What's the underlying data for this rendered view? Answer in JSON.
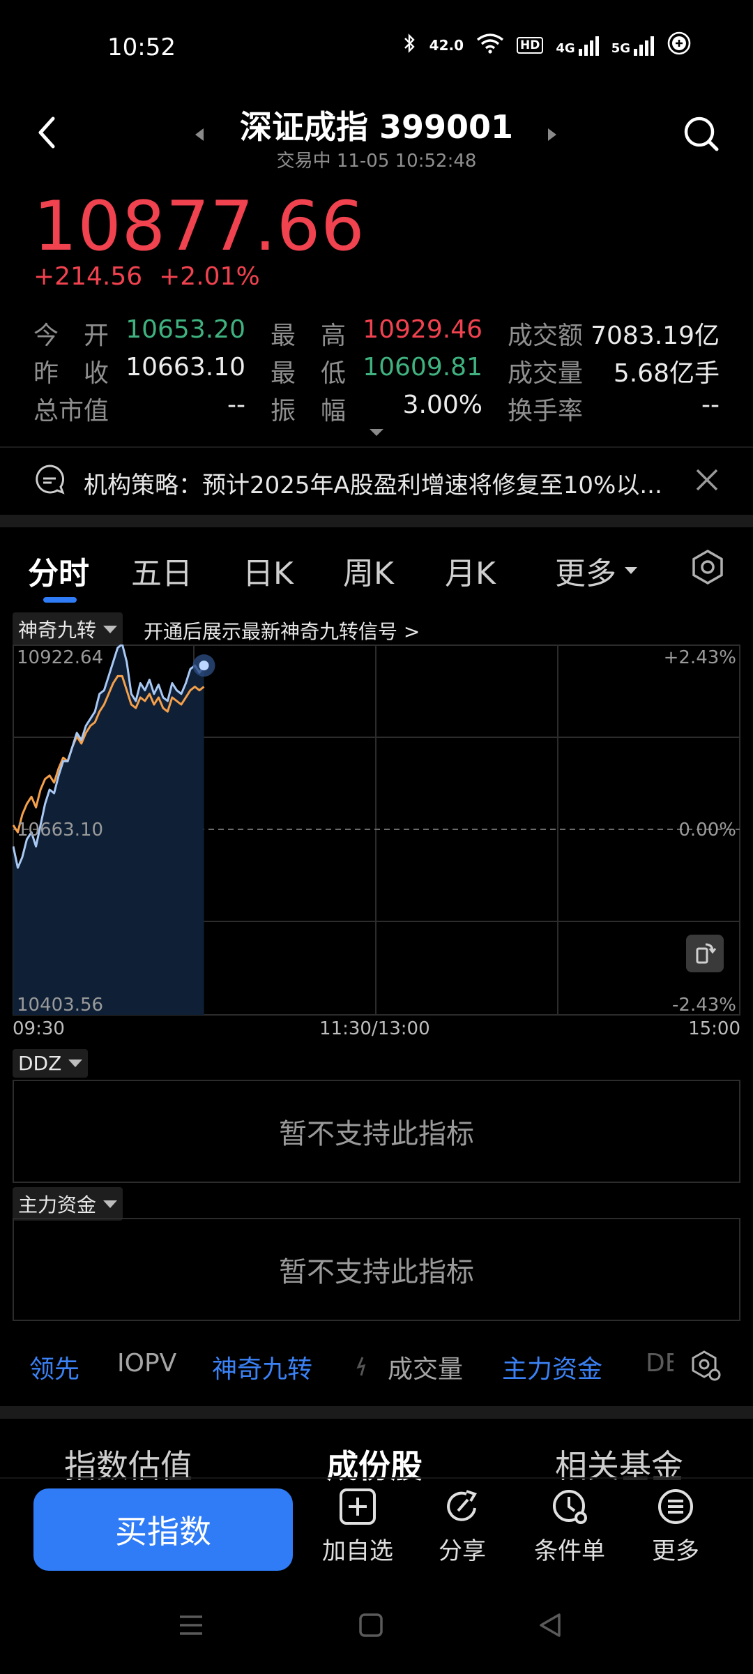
{
  "status_bar": {
    "time": "10:52",
    "speed": "42.0",
    "hd_label": "HD",
    "net1": "4G",
    "net2": "5G"
  },
  "header": {
    "title": "深证成指 399001",
    "subtitle": "交易中 11-05 10:52:48"
  },
  "quote": {
    "price": "10877.66",
    "change": "+214.56",
    "change_pct": "+2.01%",
    "stats": [
      {
        "label": "今　开",
        "value": "10653.20",
        "color": "green"
      },
      {
        "label": "最　高",
        "value": "10929.46",
        "color": "red"
      },
      {
        "label": "成交额",
        "value": "7083.19亿",
        "color": "white"
      },
      {
        "label": "昨　收",
        "value": "10663.10",
        "color": "white"
      },
      {
        "label": "最　低",
        "value": "10609.81",
        "color": "green"
      },
      {
        "label": "成交量",
        "value": "5.68亿手",
        "color": "white"
      },
      {
        "label": "总市值",
        "value": "--",
        "color": "white"
      },
      {
        "label": "振　幅",
        "value": "3.00%",
        "color": "white"
      },
      {
        "label": "换手率",
        "value": "--",
        "color": "white"
      }
    ]
  },
  "news": {
    "text": "机构策略：预计2025年A股盈利增速将修复至10%以..."
  },
  "chart_tabs": [
    "分时",
    "五日",
    "日K",
    "周K",
    "月K",
    "更多"
  ],
  "chart_header": {
    "indicator": "神奇九转",
    "promo": "开通后展示最新神奇九转信号 >"
  },
  "chart_data": {
    "type": "line",
    "y_labels": {
      "top": "10922.64",
      "mid": "10663.10",
      "bottom": "10403.56"
    },
    "pct_labels": {
      "top": "+2.43%",
      "mid": "0.00%",
      "bottom": "-2.43%"
    },
    "x_labels": [
      "09:30",
      "11:30/13:00",
      "15:00"
    ],
    "ylim": [
      10403.56,
      10922.64
    ],
    "x_minutes_total": 240,
    "series": [
      {
        "color": "#a9c9f5",
        "values": [
          10640,
          10610,
          10625,
          10650,
          10660,
          10640,
          10670,
          10700,
          10720,
          10715,
          10740,
          10760,
          10760,
          10780,
          10800,
          10790,
          10810,
          10820,
          10830,
          10855,
          10860,
          10880,
          10900,
          10920,
          10925,
          10900,
          10855,
          10845,
          10870,
          10860,
          10875,
          10855,
          10868,
          10850,
          10845,
          10870,
          10860,
          10855,
          10870,
          10890,
          10895,
          10885,
          10895
        ],
        "minutes_step": 1.5
      },
      {
        "color": "#f5a04a",
        "values": [
          10670,
          10660,
          10685,
          10700,
          10710,
          10695,
          10720,
          10735,
          10740,
          10730,
          10750,
          10765,
          10760,
          10780,
          10795,
          10785,
          10800,
          10810,
          10815,
          10830,
          10840,
          10855,
          10870,
          10880,
          10880,
          10860,
          10840,
          10835,
          10850,
          10845,
          10855,
          10840,
          10850,
          10835,
          10830,
          10850,
          10845,
          10840,
          10850,
          10860,
          10865,
          10860,
          10865
        ],
        "minutes_step": 1.5
      }
    ]
  },
  "indicator_panels": [
    {
      "name": "DDZ",
      "message": "暂不支持此指标"
    },
    {
      "name": "主力资金",
      "message": "暂不支持此指标"
    }
  ],
  "indicator_strip": [
    {
      "label": "领先",
      "style": "blue"
    },
    {
      "label": "IOPV",
      "style": "gray"
    },
    {
      "label": "神奇九转",
      "style": "blue"
    },
    {
      "label": "成交量",
      "style": "gray"
    },
    {
      "label": "主力资金",
      "style": "blue"
    },
    {
      "label": "DE",
      "style": "gray"
    }
  ],
  "bottom_tabs": [
    "指数估值",
    "成份股",
    "相关基金"
  ],
  "action_bar": {
    "buy_label": "买指数",
    "actions": [
      "加自选",
      "分享",
      "条件单",
      "更多"
    ]
  },
  "colors": {
    "up": "#f0424f",
    "down": "#3fb27f",
    "accent": "#2f7cf6"
  }
}
